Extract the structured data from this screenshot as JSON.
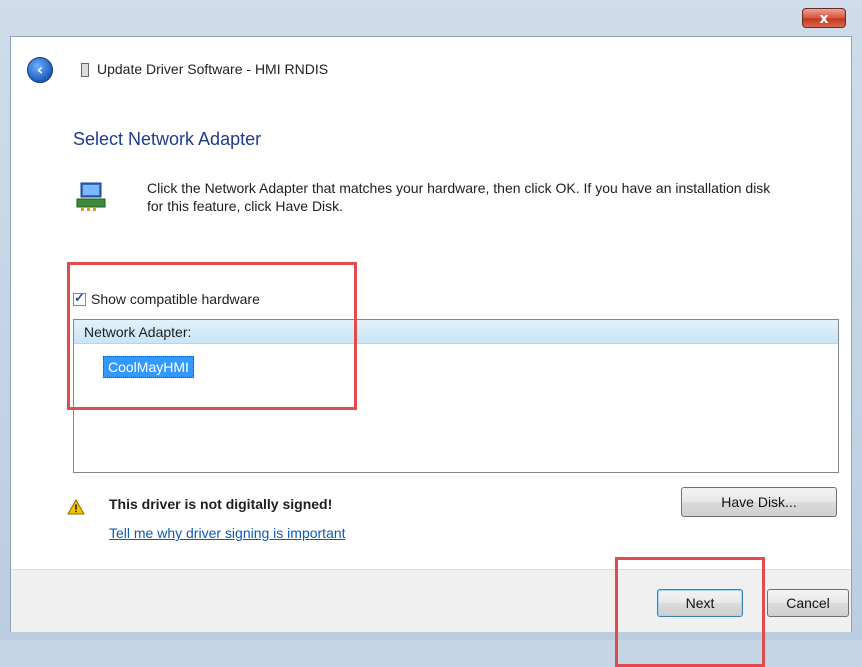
{
  "window": {
    "title": "Update Driver Software - HMI RNDIS",
    "close_glyph": "x"
  },
  "page": {
    "heading": "Select Network Adapter",
    "instructions": "Click the Network Adapter that matches your hardware, then click OK. If you have an installation disk for this feature, click Have Disk."
  },
  "options": {
    "show_compatible_label": "Show compatible hardware",
    "show_compatible_checked": true
  },
  "list": {
    "header": "Network Adapter:",
    "items": [
      "CoolMayHMI"
    ],
    "selected_index": 0
  },
  "warning": {
    "text": "This driver is not digitally signed!",
    "link": "Tell me why driver signing is important"
  },
  "buttons": {
    "have_disk": "Have Disk...",
    "next": "Next",
    "cancel": "Cancel"
  },
  "icons": {
    "back": "back-arrow-icon",
    "device": "device-icon",
    "adapter": "network-adapter-icon",
    "warning": "warning-icon"
  },
  "colors": {
    "heading": "#1e3c8c",
    "selection": "#3399ff",
    "link": "#0b5bb5",
    "annotation": "#e24b4b"
  }
}
